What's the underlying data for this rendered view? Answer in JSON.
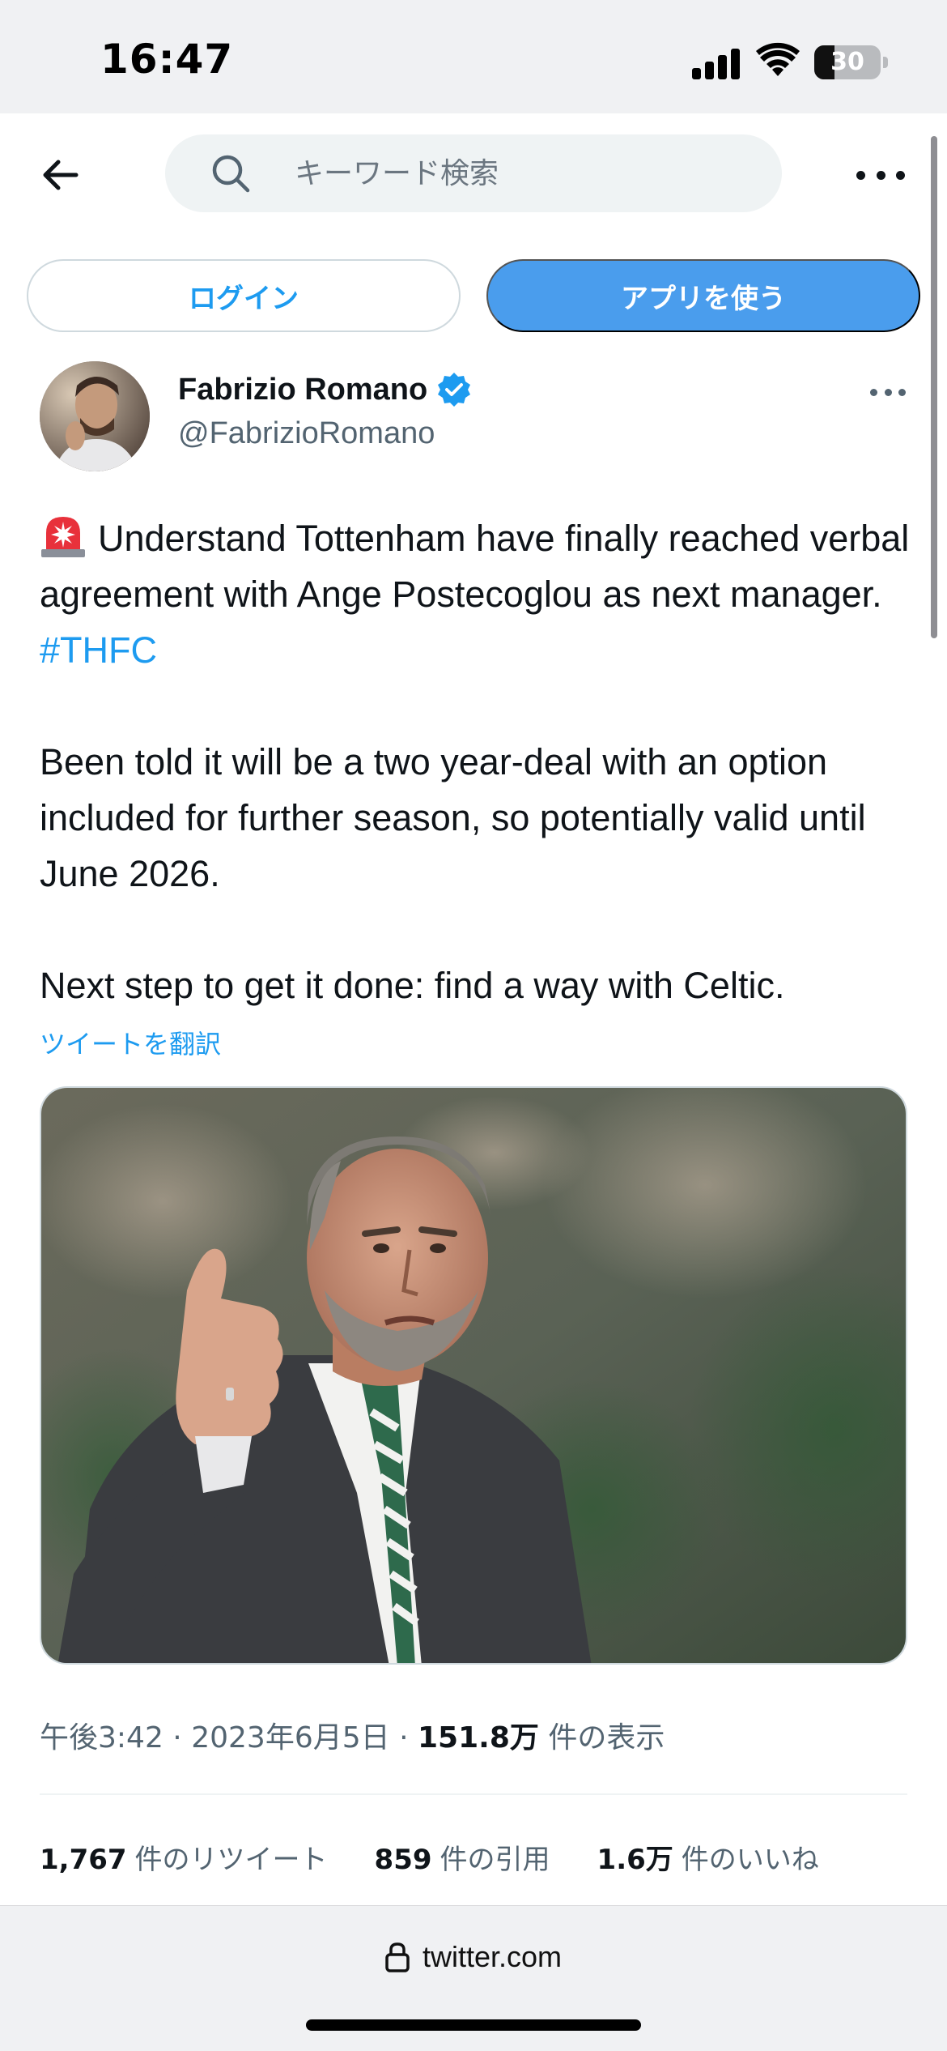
{
  "status_bar": {
    "time": "16:47",
    "battery_level": "30",
    "battery_fraction": 0.3
  },
  "header": {
    "search_placeholder": "キーワード検索",
    "back_icon": "arrow-left-icon",
    "search_icon": "magnifier-icon",
    "more_icon": "ellipsis-icon"
  },
  "auth": {
    "login_label": "ログイン",
    "app_label": "アプリを使う"
  },
  "tweet": {
    "author_name": "Fabrizio Romano",
    "author_handle": "@FabrizioRomano",
    "verified": true,
    "paragraph1_text": "Understand Tottenham have finally reached verbal agreement with Ange Postecoglou as next manager.",
    "hashtag": "#THFC",
    "paragraph2": "Been told it will be a two year-deal with an option included for further season, so potentially valid until June 2026.",
    "paragraph3": "Next step to get it done: find a way with Celtic.",
    "translate_label": "ツイートを翻訳",
    "time": "午後3:42",
    "date": "2023年6月5日",
    "views_count": "151.8万",
    "views_label": "件の表示",
    "separator": "·",
    "retweets_count": "1,767",
    "retweets_label": "件のリツイート",
    "quotes_count": "859",
    "quotes_label": "件の引用",
    "likes_count": "1.6万",
    "likes_label": "件のいいね"
  },
  "bottom_bar": {
    "url": "twitter.com"
  },
  "colors": {
    "accent": "#1d9bf0",
    "app_button": "#4a9ded",
    "text": "#0f1419",
    "muted": "#536471"
  }
}
